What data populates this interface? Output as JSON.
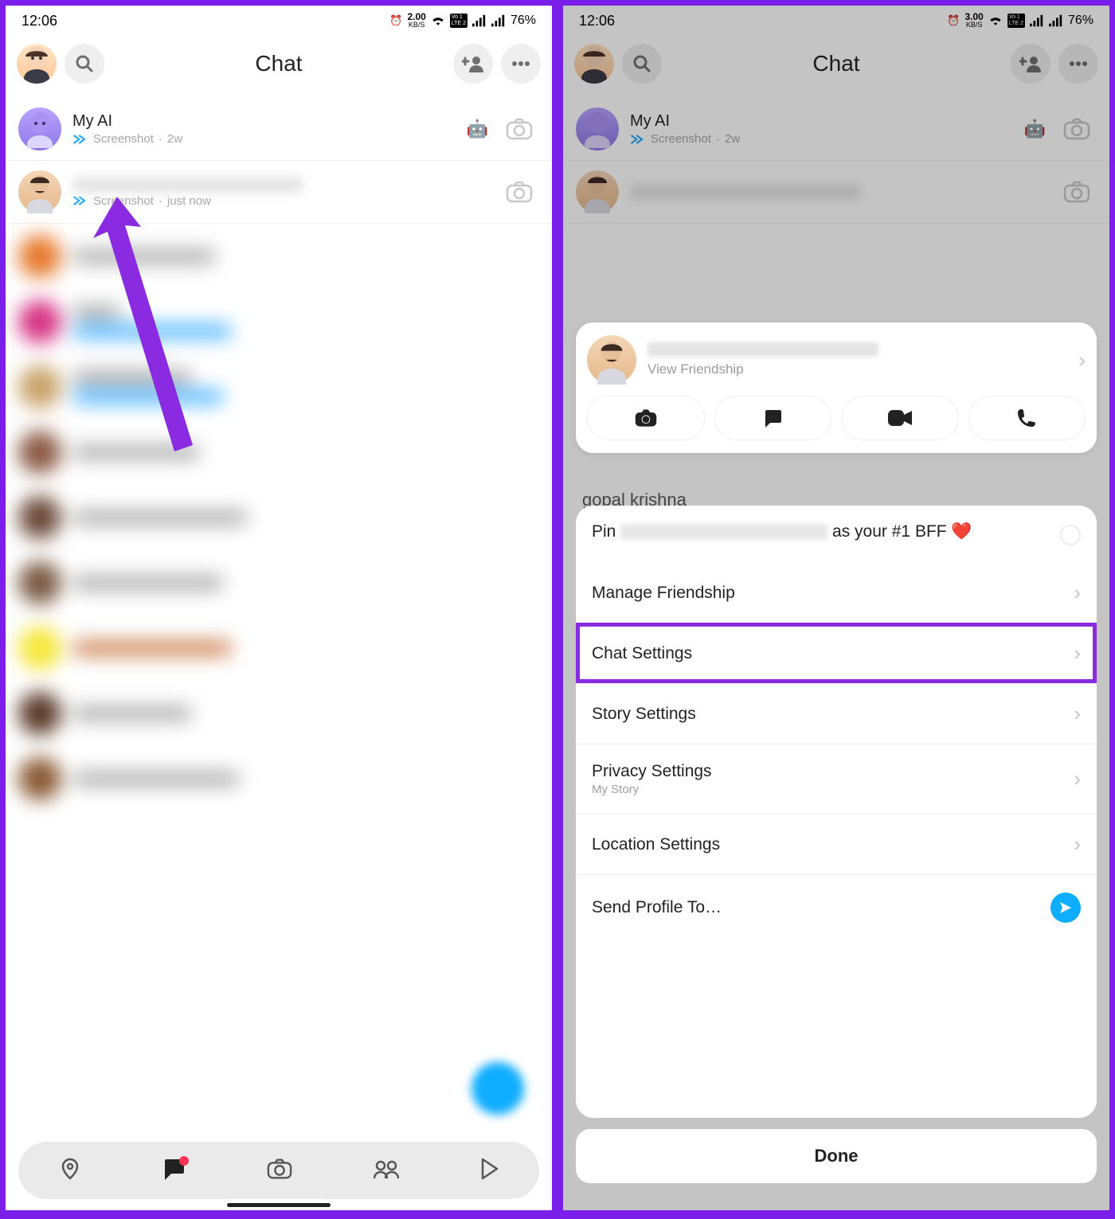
{
  "statusbar": {
    "time": "12:06",
    "kbs_left": "2.00",
    "kbs_right": "3.00",
    "kbs_label": "KB/S",
    "battery": "76%"
  },
  "header": {
    "title": "Chat"
  },
  "chats": {
    "ai": {
      "name": "My AI",
      "status": "Screenshot",
      "time": "2w"
    },
    "friend": {
      "status": "Screenshot",
      "time": "just now"
    }
  },
  "sheet": {
    "view_friendship": "View Friendship",
    "peek_name": "gopal krishna",
    "pin_prefix": "Pin",
    "pin_suffix": "as your #1 BFF ❤️",
    "options": {
      "manage": "Manage Friendship",
      "chat_settings": "Chat Settings",
      "story_settings": "Story Settings",
      "privacy": "Privacy Settings",
      "privacy_sub": "My Story",
      "location": "Location Settings",
      "send_profile": "Send Profile To…"
    },
    "done": "Done"
  }
}
